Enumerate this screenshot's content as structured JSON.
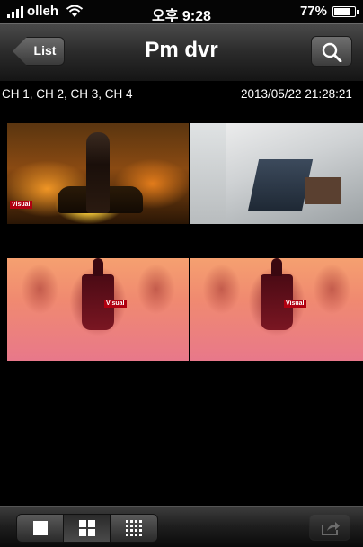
{
  "status_bar": {
    "carrier": "olleh",
    "time": "오후 9:28",
    "battery": "77%",
    "battery_level": 0.77
  },
  "nav": {
    "back_label": "List",
    "title": "Pm dvr",
    "search_icon": "search-icon"
  },
  "info": {
    "channels": "CH 1, CH 2, CH 3, CH 4",
    "timestamp": "2013/05/22 21:28:21"
  },
  "cameras": [
    {
      "channel": "CH 1",
      "brand": "Visual"
    },
    {
      "channel": "CH 2",
      "brand": ""
    },
    {
      "channel": "CH 3",
      "brand": "Visual"
    },
    {
      "channel": "CH 4",
      "brand": "Visual"
    }
  ],
  "toolbar": {
    "layouts": [
      "single-view-icon",
      "quad-view-icon",
      "nine-view-icon"
    ],
    "selected_layout": "quad-view-icon",
    "share_icon": "share-icon",
    "share_enabled": false
  },
  "colors": {
    "accent": "#ffffff",
    "background": "#000000"
  }
}
